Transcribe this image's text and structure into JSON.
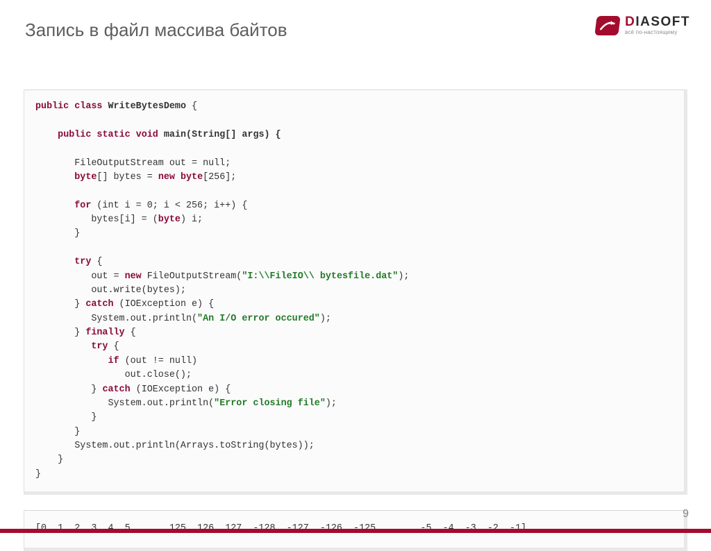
{
  "header": {
    "title": "Запись в файл массива байтов"
  },
  "logo": {
    "brand_prefix": "D",
    "brand_rest": "IASOFT",
    "tagline": "всё по-настоящему"
  },
  "code": {
    "kw_public1": "public",
    "kw_class": "class",
    "class_name": "WriteBytesDemo",
    "brace_open1": " {",
    "kw_public2": "public",
    "kw_static": "static",
    "kw_void": "void",
    "sig_main": "main(String[] args) {",
    "line_out_null": "       FileOutputStream out = null;",
    "kw_byte": "byte",
    "arr_decl_a": "[] bytes = ",
    "kw_new1": "new",
    "kw_byte2": " byte",
    "arr_decl_b": "[256];",
    "kw_for": "for",
    "for_head": " (int i = 0; i < 256; i++) {",
    "for_body_a": "          bytes[i] = (",
    "kw_byte3": "byte",
    "for_body_b": ") i;",
    "brace_close_for": "       }",
    "kw_try1": "try",
    "try_open": " {",
    "kw_new2": "new",
    "out_assign_a": "          out = ",
    "out_assign_b": " FileOutputStream(",
    "str_path": "\"I:\\\\FileIO\\\\ bytesfile.dat\"",
    "out_assign_c": ");",
    "out_write": "          out.write(bytes);",
    "catch1_a": "       } ",
    "kw_catch1": "catch",
    "catch1_b": " (IOException e) {",
    "println1_a": "          System.out.println(",
    "str_ioerr": "\"An I/O error occured\"",
    "println1_b": ");",
    "finally_a": "       } ",
    "kw_finally": "finally",
    "finally_b": " {",
    "kw_try2": "try",
    "try2_indent": "          ",
    "try2_open": " {",
    "kw_if": "if",
    "if_indent": "             ",
    "if_cond": " (out != null)",
    "close_call": "                out.close();",
    "catch2_a": "          } ",
    "kw_catch2": "catch",
    "catch2_b": " (IOException e) {",
    "println2_a": "             System.out.println(",
    "str_closeerr": "\"Error closing file\"",
    "println2_b": ");",
    "brace_close2a": "          }",
    "brace_close2b": "       }",
    "println3": "       System.out.println(Arrays.toString(bytes));",
    "brace_close3": "    }",
    "brace_close4": "}"
  },
  "output": {
    "text": "[0, 1, 2, 3, 4, 5, ... ,125, 126, 127, -128, -127, -126, -125, ... , -5, -4, -3, -2, -1]"
  },
  "footer": {
    "page_number": "9"
  }
}
